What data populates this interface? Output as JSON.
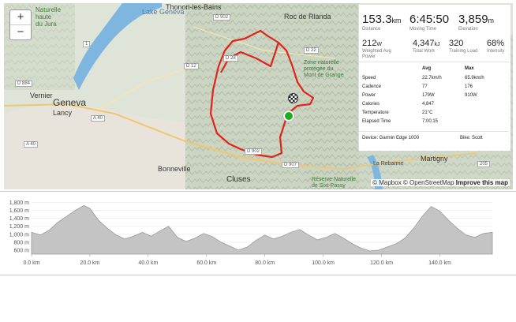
{
  "map": {
    "zoom_in": "+",
    "zoom_out": "−",
    "labels": {
      "lake_geneva": "Lake Geneva",
      "thonon": "Thonon-les-Bains",
      "geneva": "Geneva",
      "vernier": "Vernier",
      "lancy": "Lancy",
      "bonneville": "Bonneville",
      "cluses": "Cluses",
      "martigny": "Martigny",
      "roc": "Roc de Rlanda",
      "jura": "Naturelle\nhaute\ndu Jura",
      "zone": "Zone naturelle\nprotégée du\nMont de Grange",
      "reserve": "Réserve Naturelle\nde Sixt-Passy",
      "rebarme": "La Rebarme"
    },
    "roads": {
      "d902_top": "D 902",
      "d22": "D 22",
      "d12": "D 12",
      "d28": "D 28",
      "d884": "D 884",
      "a40_1": "A 40",
      "a40_2": "A 40",
      "d902_mid": "D 902",
      "d907": "D 907",
      "r1": "1",
      "r205": "205"
    },
    "attribution": {
      "mapbox": "© Mapbox",
      "osm": "© OpenStreetMap",
      "improve": "Improve this map"
    }
  },
  "stats": {
    "distance": {
      "value": "153.3",
      "unit": "km",
      "label": "Distance"
    },
    "moving_time": {
      "value": "6:45:50",
      "label": "Moving Time"
    },
    "elevation": {
      "value": "3,859",
      "unit": "m",
      "label": "Elevation"
    },
    "weighted_power": {
      "value": "212",
      "unit": "W",
      "label": "Weighted Avg\nPower"
    },
    "total_work": {
      "value": "4,347",
      "unit": "kJ",
      "label": "Total Work"
    },
    "training_load": {
      "value": "320",
      "label": "Training Load"
    },
    "intensity": {
      "value": "68%",
      "label": "Intensity"
    },
    "table_header": {
      "avg": "Avg",
      "max": "Max"
    },
    "rows": [
      {
        "name": "Speed",
        "avg": "22.7km/h",
        "max": "65.9km/h"
      },
      {
        "name": "Cadence",
        "avg": "77",
        "max": "176"
      },
      {
        "name": "Power",
        "avg": "179W",
        "max": "910W"
      },
      {
        "name": "Calories",
        "avg": "4,847",
        "max": ""
      },
      {
        "name": "Temperature",
        "avg": "21°C",
        "max": ""
      },
      {
        "name": "Elapsed Time",
        "avg": "7:00:15",
        "max": ""
      }
    ],
    "device": "Device: Garmin Edge 1000",
    "bike": "Bike: Scott"
  },
  "colors": {
    "route": "#e0241b",
    "lake": "#7fb6e0",
    "elevation_fill": "#c4c4c4",
    "start_marker": "#22aa22"
  },
  "elevation_profile": {
    "y_ticks": [
      "1,800 m",
      "1,600 m",
      "1,400 m",
      "1,200 m",
      "1,000 m",
      "800 m",
      "600 m"
    ],
    "x_ticks": [
      "0.0 km",
      "20.0 km",
      "40.0 km",
      "60.0 km",
      "80.0 km",
      "100.0 km",
      "120.0 km",
      "140.0 km"
    ]
  },
  "chart_data": {
    "type": "area",
    "xlabel": "",
    "ylabel": "",
    "xlim": [
      0,
      158
    ],
    "ylim": [
      500,
      1850
    ],
    "x": [
      0,
      3,
      6,
      9,
      12,
      15,
      18,
      20,
      23,
      26,
      29,
      32,
      35,
      38,
      41,
      44,
      47,
      50,
      53,
      56,
      59,
      62,
      65,
      68,
      71,
      74,
      77,
      80,
      83,
      86,
      89,
      92,
      95,
      98,
      101,
      104,
      107,
      110,
      113,
      116,
      119,
      122,
      125,
      128,
      131,
      134,
      137,
      140,
      143,
      146,
      149,
      152,
      155,
      158
    ],
    "series": [
      {
        "values": [
          1050,
          980,
          1100,
          1300,
          1450,
          1600,
          1720,
          1650,
          1350,
          1150,
          980,
          880,
          950,
          1050,
          950,
          1080,
          1200,
          920,
          820,
          900,
          1020,
          940,
          800,
          700,
          600,
          680,
          850,
          980,
          880,
          950,
          1050,
          1120,
          980,
          860,
          920,
          1020,
          900,
          760,
          650,
          580,
          600,
          680,
          760,
          900,
          1150,
          1450,
          1700,
          1580,
          1350,
          1150,
          980,
          920,
          1020,
          1050
        ]
      }
    ]
  }
}
